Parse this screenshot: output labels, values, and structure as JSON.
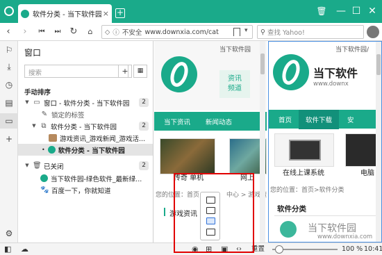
{
  "tab": {
    "title": "软件分类 - 当下软件园",
    "close": "×"
  },
  "new_tab": "+",
  "window_controls": {
    "trash": "🗑",
    "minimize": "—",
    "maximize": "☐",
    "close": "✕"
  },
  "address": {
    "not_secure": "不安全",
    "url": "www.downxia.com/cat",
    "search_placeholder": "查找 Yahoo!"
  },
  "panel": {
    "title": "窗口",
    "search_placeholder": "搜索",
    "add": "+",
    "section": "手动排序",
    "rows": [
      {
        "label": "窗口 - 软件分类 - 当下软件园",
        "count": "2"
      },
      {
        "label": "锁定的标签"
      },
      {
        "label": "软件分类 - 当下软件园",
        "count": "2"
      },
      {
        "label": "游戏资讯_游戏新闻_游戏活..."
      },
      {
        "label": "软件分类 - 当下软件园"
      },
      {
        "label": "已关闭",
        "count": "2"
      },
      {
        "label": "当下软件园-绿色软件_最新绿..."
      },
      {
        "label": "百度一下，你就知道"
      }
    ]
  },
  "page1": {
    "site": "当下软件园",
    "badge": "资讯\n频道",
    "nav": [
      "当下资讯",
      "新闻动态"
    ],
    "thumb_labels": [
      "传奇 单机",
      "网上"
    ],
    "breadcrumb": "您的位置：首页",
    "breadcrumb_tail": "中心 > 游戏资",
    "section": "游戏资讯"
  },
  "page2": {
    "site": "当下软件园/",
    "brand": "当下软件",
    "domain": "www.downx",
    "nav": [
      "首页",
      "软件下载",
      "安"
    ],
    "thumb_labels": [
      "在线上课系统",
      "电脑"
    ],
    "breadcrumb": "您的位置：首页>软件分类",
    "section": "软件分类",
    "watermark": "当下软件园",
    "watermark_url": "www.downxia.com"
  },
  "statusbar": {
    "reset": "重置",
    "zoom": "100 %",
    "time": "10:41"
  },
  "colors": {
    "accent": "#1aaa8a",
    "highlight": "#e10000",
    "focus": "#4a90e2"
  }
}
